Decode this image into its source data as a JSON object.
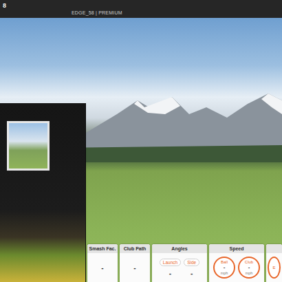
{
  "header": {
    "title": "8",
    "subtitle": "EDGE_58 | PREMIUM"
  },
  "stats": [
    {
      "label": "Smash Fac.",
      "kind": "single",
      "value": "-"
    },
    {
      "label": "Club Path",
      "kind": "single",
      "value": "-"
    },
    {
      "label": "Angles",
      "kind": "pair",
      "items": [
        {
          "label": "Launch",
          "value": "-"
        },
        {
          "label": "Side",
          "value": "-"
        }
      ]
    },
    {
      "label": "Speed",
      "kind": "gauges",
      "items": [
        {
          "label": "Ball",
          "value": "-",
          "unit": "mph"
        },
        {
          "label": "Club",
          "value": "-",
          "unit": "mph"
        }
      ]
    },
    {
      "label": "E",
      "kind": "partial"
    }
  ]
}
